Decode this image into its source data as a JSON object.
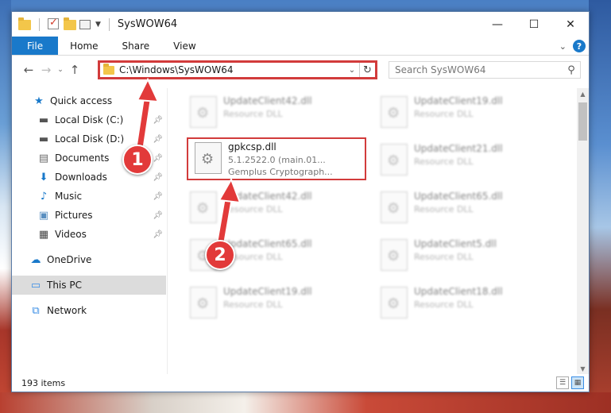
{
  "window": {
    "title": "SysWOW64",
    "controls": {
      "minimize": "—",
      "maximize": "☐",
      "close": "✕"
    }
  },
  "ribbon": {
    "tabs": [
      "File",
      "Home",
      "Share",
      "View"
    ],
    "help": "?"
  },
  "nav": {
    "address": "C:\\Windows\\SysWOW64",
    "search_placeholder": "Search SysWOW64"
  },
  "sidebar": {
    "items": [
      {
        "label": "Quick access",
        "icon": "star-icon",
        "glyph": "★",
        "color": "#1979ca"
      },
      {
        "label": "Local Disk (C:)",
        "icon": "drive-icon",
        "glyph": "▬",
        "color": "#555555",
        "pinned": true
      },
      {
        "label": "Local Disk (D:)",
        "icon": "drive-icon",
        "glyph": "▬",
        "color": "#555555",
        "pinned": true
      },
      {
        "label": "Documents",
        "icon": "documents-icon",
        "glyph": "▤",
        "color": "#6b6b6b",
        "pinned": true
      },
      {
        "label": "Downloads",
        "icon": "downloads-icon",
        "glyph": "⬇",
        "color": "#1979ca",
        "pinned": true
      },
      {
        "label": "Music",
        "icon": "music-icon",
        "glyph": "♪",
        "color": "#1979ca",
        "pinned": true
      },
      {
        "label": "Pictures",
        "icon": "pictures-icon",
        "glyph": "▣",
        "color": "#5a8fc0",
        "pinned": true
      },
      {
        "label": "Videos",
        "icon": "videos-icon",
        "glyph": "▦",
        "color": "#444444",
        "pinned": true
      },
      {
        "label": "OneDrive",
        "icon": "onedrive-icon",
        "glyph": "☁",
        "color": "#1979ca"
      },
      {
        "label": "This PC",
        "icon": "computer-icon",
        "glyph": "▭",
        "color": "#3a8ee6",
        "selected": true
      },
      {
        "label": "Network",
        "icon": "network-icon",
        "glyph": "⧉",
        "color": "#3a8ee6"
      }
    ]
  },
  "files": {
    "highlighted": {
      "name": "gpkcsp.dll",
      "version": "5.1.2522.0 (main.01...",
      "description": "Gemplus Cryptograph..."
    },
    "blurred": [
      {
        "name": "UpdateClient42.dll",
        "type": "Resource DLL"
      },
      {
        "name": "UpdateClient19.dll",
        "type": "Resource DLL"
      },
      {
        "name": "UpdateClient21.dll",
        "type": "Resource DLL"
      },
      {
        "name": "UpdateClient42.dll",
        "type": "Resource DLL"
      },
      {
        "name": "UpdateClient65.dll",
        "type": "Resource DLL"
      },
      {
        "name": "UpdateClient65.dll",
        "type": "Resource DLL"
      },
      {
        "name": "UpdateClient5.dll",
        "type": "Resource DLL"
      },
      {
        "name": "UpdateClient19.dll",
        "type": "Resource DLL"
      },
      {
        "name": "UpdateClient18.dll",
        "type": "Resource DLL"
      }
    ]
  },
  "status": {
    "items_count": "193 items"
  },
  "annotations": {
    "callout1": "1",
    "callout2": "2"
  },
  "colors": {
    "accent": "#1979ca",
    "highlight": "#d23b3b",
    "callout": "#e23a3a"
  }
}
